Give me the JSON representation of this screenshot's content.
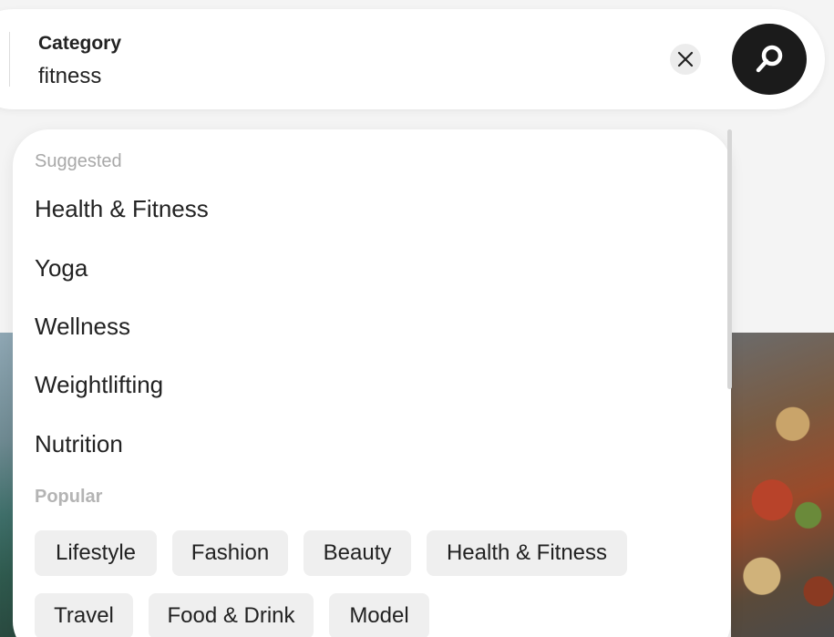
{
  "search": {
    "category_label": "Category",
    "category_value": "fitness"
  },
  "dropdown": {
    "suggested_label": "Suggested",
    "suggested_items": [
      "Health & Fitness",
      "Yoga",
      "Wellness",
      "Weightlifting",
      "Nutrition"
    ],
    "popular_label": "Popular",
    "popular_chips": [
      "Lifestyle",
      "Fashion",
      "Beauty",
      "Health & Fitness",
      "Travel",
      "Food & Drink",
      "Model"
    ]
  },
  "icons": {
    "clear": "close-icon",
    "search": "search-icon"
  },
  "colors": {
    "search_button": "#1b1b1b",
    "chip_background": "#efefef",
    "muted_text": "#a8a8a8"
  }
}
